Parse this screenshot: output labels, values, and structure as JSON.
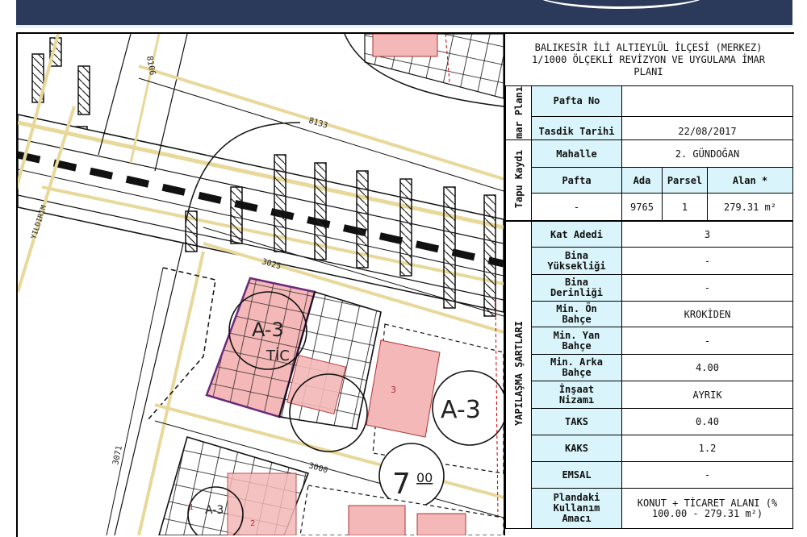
{
  "panel": {
    "title": "BALIKESİR İLİ ALTIEYLÜL İLÇESİ (MERKEZ)\n1/1000 ÖLÇEKLİ REVİZYON VE UYGULAMA İMAR\nPLANI",
    "imar_plani_label": "İmar Planı",
    "pafta_no_label": "Pafta No",
    "pafta_no_value": "",
    "tasdik_tarihi_label": "Tasdik Tarihi",
    "tasdik_tarihi_value": "22/08/2017",
    "tapu_kaydi_label": "Tapu Kaydı",
    "mahalle_label": "Mahalle",
    "mahalle_value": "2. GÜNDOĞAN",
    "col_headers": {
      "pafta": "Pafta",
      "ada": "Ada",
      "parsel": "Parsel",
      "alan": "Alan *"
    },
    "row_values": {
      "pafta": "-",
      "ada": "9765",
      "parsel": "1",
      "alan": "279.31 m²"
    },
    "yapilasma_label": "YAPILAŞMA ŞARTLARI",
    "conditions": [
      {
        "label": "Kat Adedi",
        "value": "3"
      },
      {
        "label": "Bina\nYüksekliği",
        "value": "-"
      },
      {
        "label": "Bina\nDerinliği",
        "value": "-"
      },
      {
        "label": "Min. Ön\nBahçe",
        "value": "KROKİDEN"
      },
      {
        "label": "Min. Yan\nBahçe",
        "value": "-"
      },
      {
        "label": "Min. Arka\nBahçe",
        "value": "4.00"
      },
      {
        "label": "İnşaat\nNizamı",
        "value": "AYRIK"
      },
      {
        "label": "TAKS",
        "value": "0.40"
      },
      {
        "label": "KAKS",
        "value": "1.2"
      },
      {
        "label": "EMSAL",
        "value": "-"
      },
      {
        "label": "Plandaki\nKullanım\nAmacı",
        "value": "KONUT + TİCARET ALANI (%\n100.00 - 279.31 m²)"
      }
    ]
  },
  "map": {
    "road_labels": {
      "r8106": "8106",
      "r8133": "8133",
      "r3025": "3025",
      "r3071": "3071",
      "r3000": "3000",
      "yildirim": "YILDIRIM"
    },
    "zone_label_main": "A-3",
    "zone_label_main_sub": "TİC",
    "zone_label_right": "A-3",
    "zone_label_bottom": "A-3",
    "parcel_number": "3",
    "parcel_number_2": "2",
    "parcel_number_3": "1",
    "height_value_main": "7",
    "height_value_sub": "00",
    "colors": {
      "parcel_fill": "#f4b8b8",
      "road_yellow": "#e8d89a",
      "plot_outline": "#6a2a7a",
      "banner": "#2b3a5a",
      "header_cyan": "#d9f5fb"
    }
  }
}
